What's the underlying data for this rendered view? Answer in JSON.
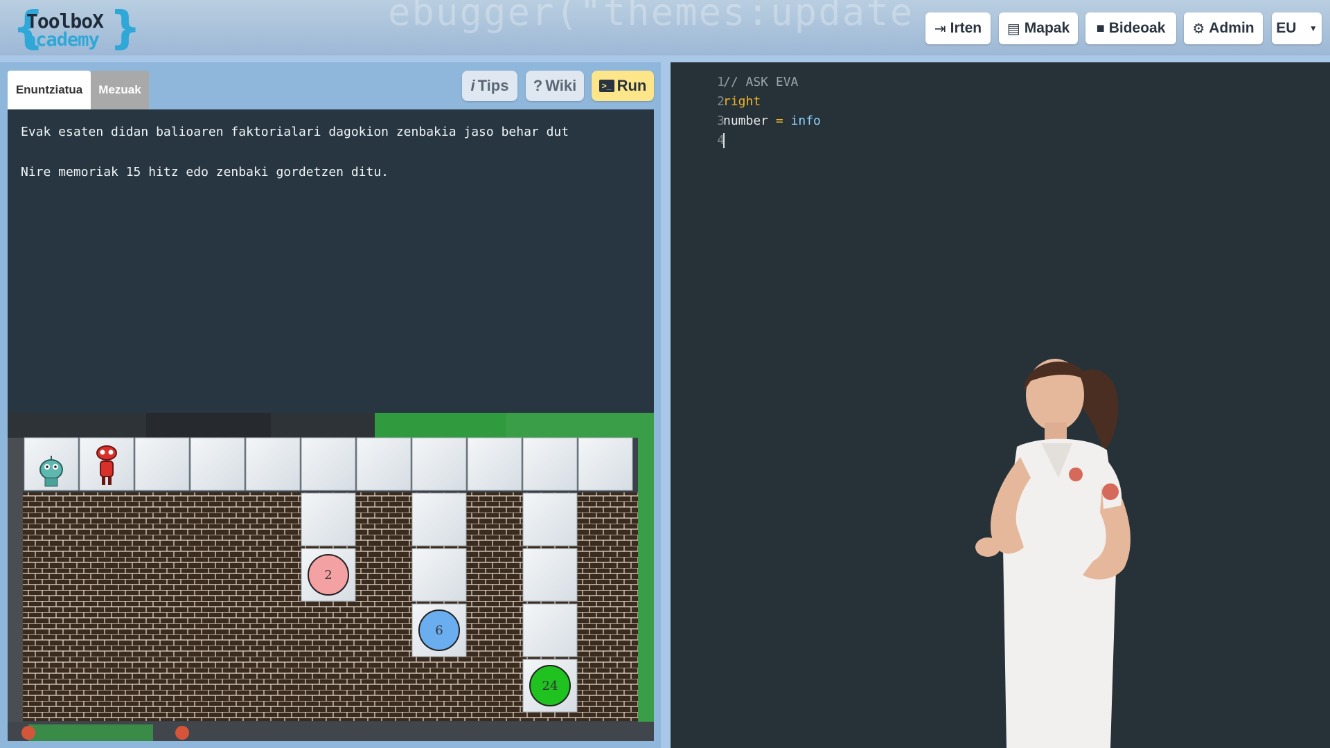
{
  "header": {
    "logo_line1": "ToolboX",
    "logo_line2": "academy",
    "bg_code": "ebugger(\"themes:update",
    "nav": [
      {
        "label": "Irten",
        "icon": "sign-out-icon"
      },
      {
        "label": "Mapak",
        "icon": "map-list-icon"
      },
      {
        "label": "Bideoak",
        "icon": "video-camera-icon"
      },
      {
        "label": "Admin",
        "icon": "gear-icon"
      }
    ],
    "language": "EU"
  },
  "left_panel": {
    "tabs": [
      "Enuntziatua",
      "Mezuak"
    ],
    "active_tab": "Enuntziatua",
    "tools": {
      "tips": "Tips",
      "wiki": "Wiki",
      "run": "Run"
    },
    "statement_lines": [
      "Evak esaten didan balioaren faktorialari dagokion zenbakia jaso behar dut",
      "Nire memoriak 15 hitz edo zenbaki gordetzen ditu."
    ],
    "game": {
      "balls": [
        {
          "value": "2",
          "color": "#f4a1a4"
        },
        {
          "value": "6",
          "color": "#6aaef0"
        },
        {
          "value": "24",
          "color": "#1fc21f"
        }
      ]
    }
  },
  "editor": {
    "lines": [
      {
        "num": "1",
        "text": "// ASK EVA",
        "kind": "comment"
      },
      {
        "num": "2",
        "text": "right",
        "kind": "keyword"
      },
      {
        "num": "3",
        "text_parts": [
          "number",
          " = ",
          "info"
        ],
        "kind": "assignment"
      },
      {
        "num": "4",
        "text": "",
        "kind": "empty"
      }
    ],
    "colors": {
      "comment": "#9aa3a8",
      "keyword": "#f0b429",
      "variable": "#e8e8e8",
      "operator": "#f0b429",
      "value": "#8fd3ff"
    }
  }
}
